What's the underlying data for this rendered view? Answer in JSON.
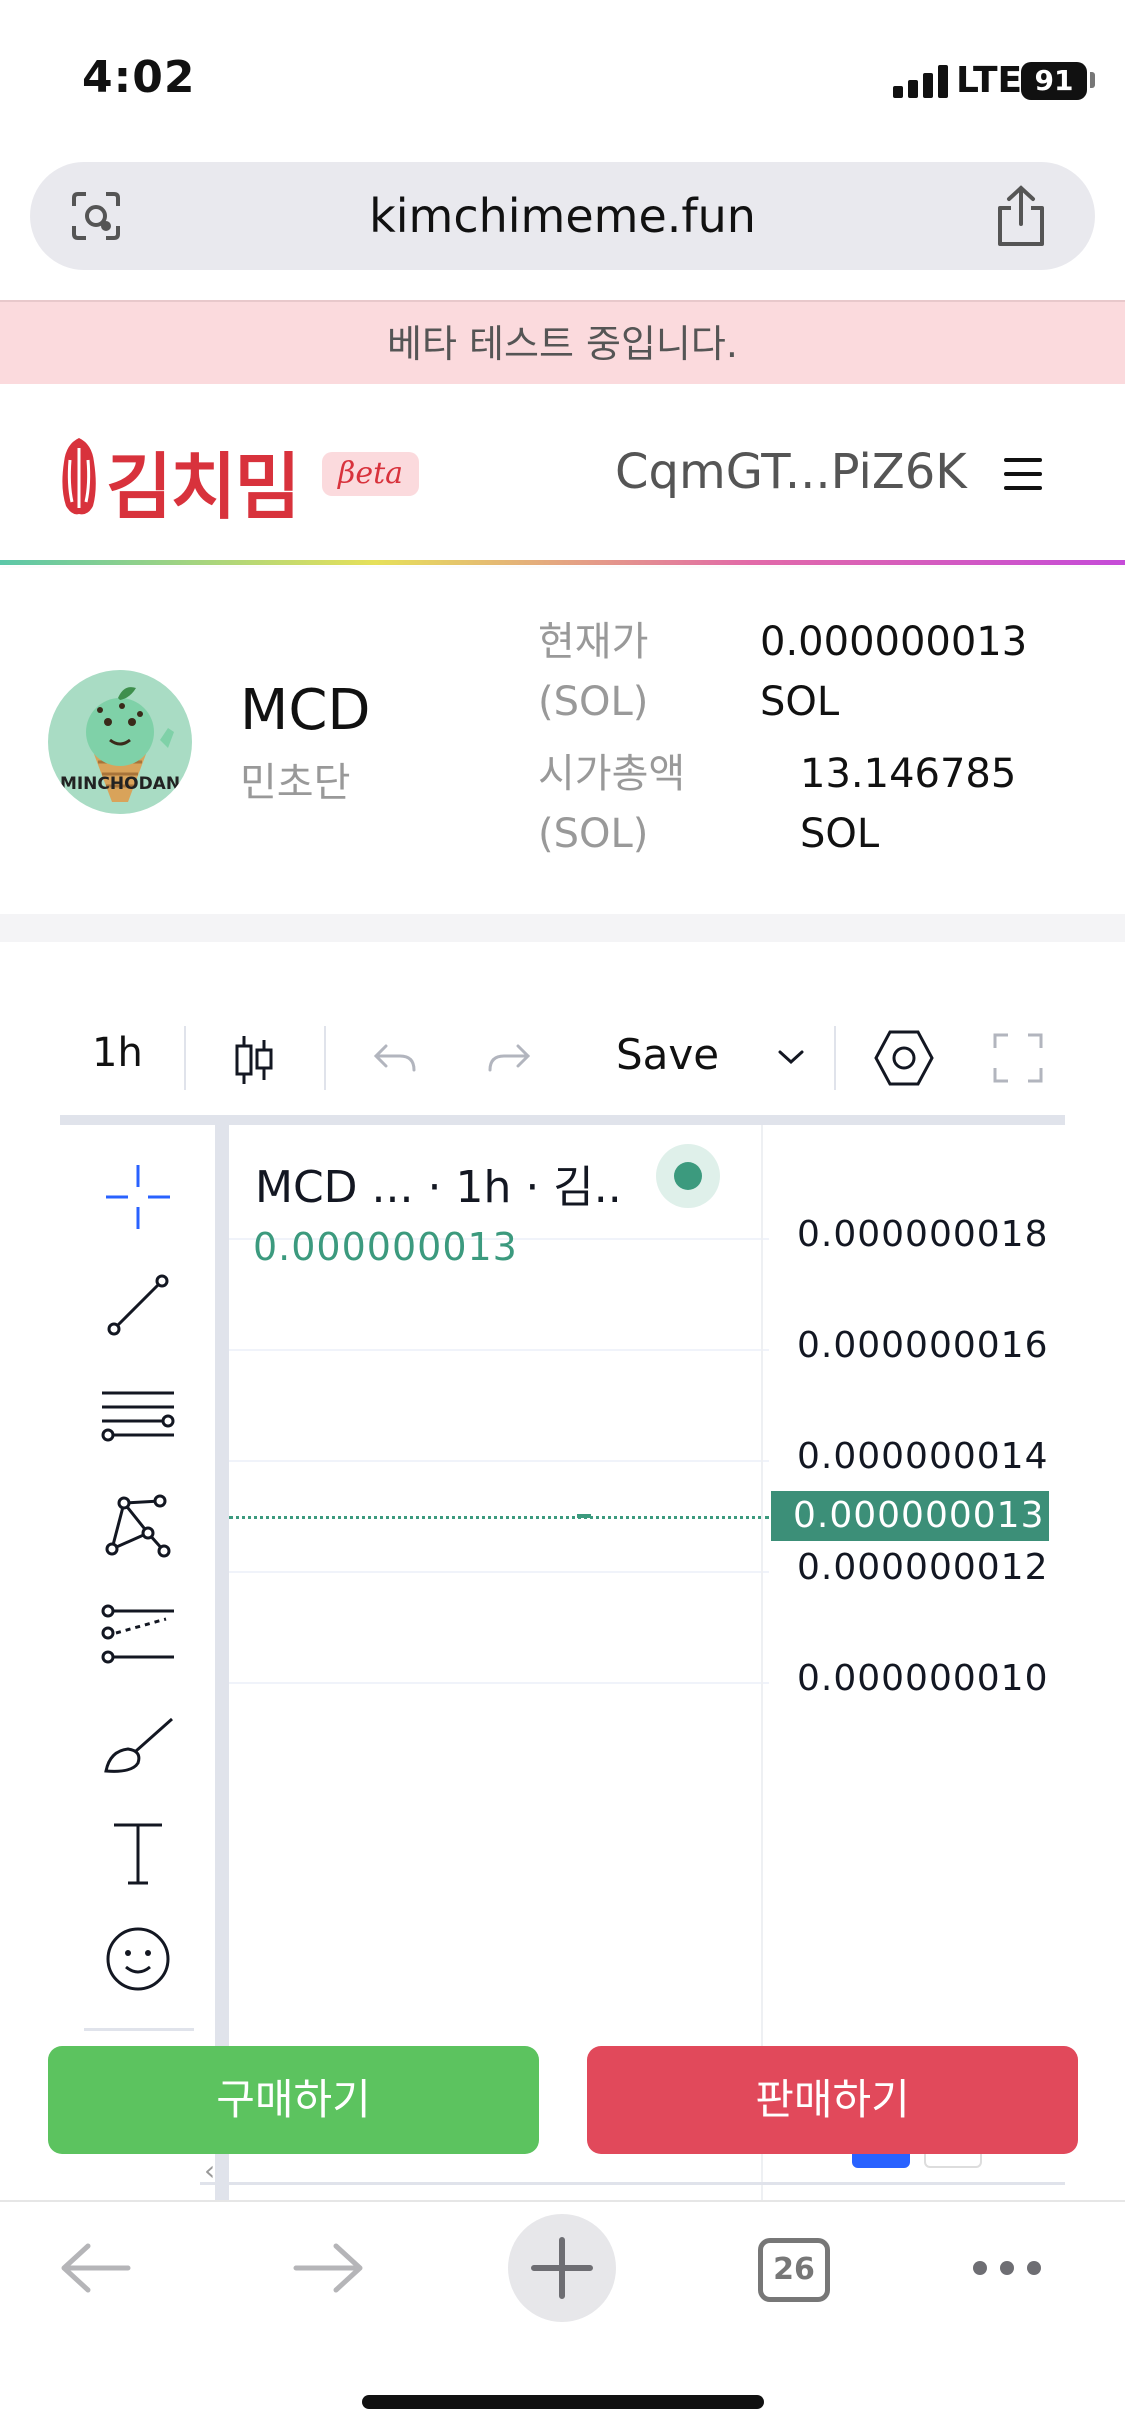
{
  "status_bar": {
    "time": "4:02",
    "network": "LTE",
    "battery": "91"
  },
  "browser": {
    "url": "kimchimeme.fun",
    "tab_count": "26"
  },
  "banner": {
    "text": "베타 테스트 중입니다."
  },
  "header": {
    "logo_text": "김치밈",
    "beta_badge": "βeta",
    "wallet_address": "CqmGT...PiZ6K"
  },
  "token": {
    "avatar_label": "MINCHODAN",
    "symbol": "MCD",
    "name": "민초단",
    "price_label_line1": "현재가",
    "price_label_line2": "(SOL)",
    "price_value_line1": "0.000000013",
    "price_value_line2": "SOL",
    "mcap_label_line1": "시가총액",
    "mcap_label_line2": "(SOL)",
    "mcap_value_line1": "13.146785",
    "mcap_value_line2": "SOL"
  },
  "chart_toolbar": {
    "interval": "1h",
    "save_label": "Save"
  },
  "chart_data": {
    "type": "line",
    "title": "MCD ... · 1h · 김..",
    "last_value_label": "0.000000013",
    "current_price_tag": "0.000000013",
    "current_price": 1.3e-08,
    "y_tick_labels": [
      "0.000000018",
      "0.000000016",
      "0.000000014",
      "0.000000012",
      "0.000000010"
    ],
    "y_ticks": [
      1.8e-08,
      1.6e-08,
      1.4e-08,
      1.2e-08,
      1e-08
    ],
    "grid": true,
    "colors": {
      "up": "#3c9a7e",
      "price_tag": "#3c8f78"
    }
  },
  "actions": {
    "buy_label": "구매하기",
    "sell_label": "판매하기"
  },
  "colors": {
    "brand": "#d8323c",
    "buy": "#5cc35f",
    "sell": "#e1495b",
    "banner_bg": "#fbdadd"
  }
}
